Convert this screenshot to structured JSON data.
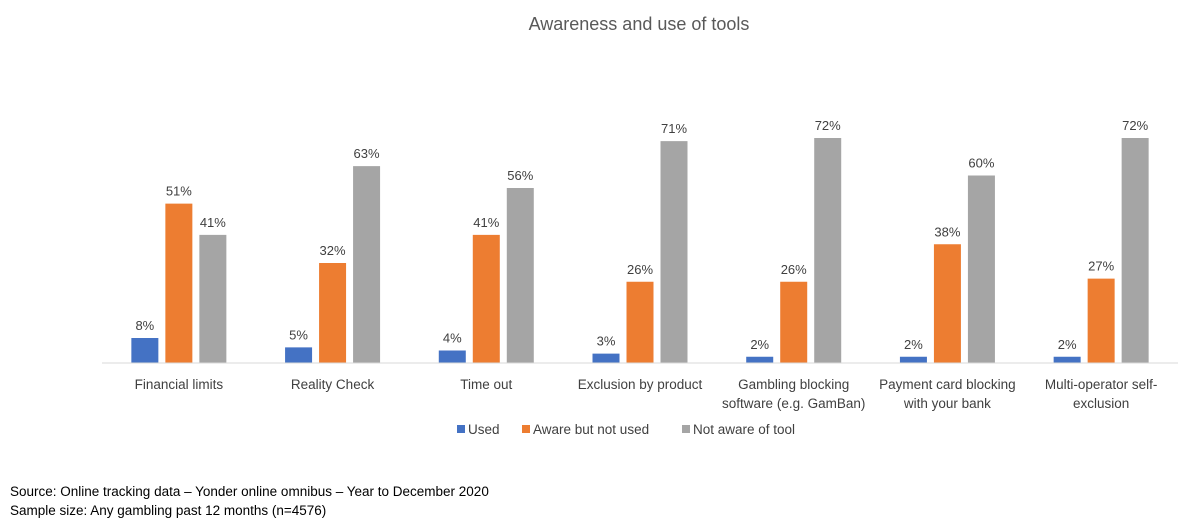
{
  "chart_data": {
    "type": "bar",
    "title": "Awareness  and use of tools",
    "xlabel": "",
    "ylabel": "",
    "ylim": [
      0,
      80
    ],
    "grid": false,
    "legend_position": "bottom",
    "categories": [
      [
        "Financial limits"
      ],
      [
        "Reality Check"
      ],
      [
        "Time out"
      ],
      [
        "Exclusion by product"
      ],
      [
        "Gambling blocking",
        "software (e.g. GamBan)"
      ],
      [
        "Payment card blocking",
        "with your bank"
      ],
      [
        "Multi-operator self-",
        "exclusion"
      ]
    ],
    "series": [
      {
        "name": "Used",
        "color": "#4472C4",
        "values": [
          8,
          5,
          4,
          3,
          2,
          2,
          2
        ]
      },
      {
        "name": "Aware but not used",
        "color": "#ED7D31",
        "values": [
          51,
          32,
          41,
          26,
          26,
          38,
          27
        ]
      },
      {
        "name": "Not aware of tool",
        "color": "#A5A5A5",
        "values": [
          41,
          63,
          56,
          71,
          72,
          60,
          72
        ]
      }
    ],
    "value_suffix": "%"
  },
  "footer": {
    "source": "Source: Online tracking data – Yonder online omnibus – Year to December 2020",
    "sample": "Sample size: Any gambling past 12 months (n=4576)"
  }
}
